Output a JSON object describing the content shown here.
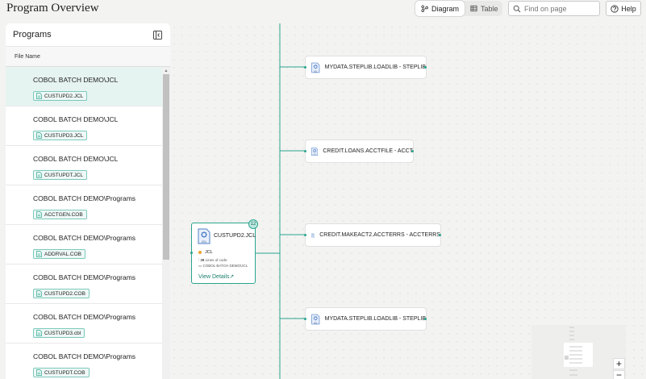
{
  "header": {
    "title": "Program Overview",
    "view_diagram": "Diagram",
    "view_table": "Table",
    "search_placeholder": "Find on page",
    "help": "Help"
  },
  "panel": {
    "title": "Programs",
    "column_header": "File Name",
    "items": [
      {
        "folder": "COBOL BATCH DEMO\\JCL",
        "file": "CUSTUPD2.JCL"
      },
      {
        "folder": "COBOL BATCH DEMO\\JCL",
        "file": "CUSTUPD3.JCL"
      },
      {
        "folder": "COBOL BATCH DEMO\\JCL",
        "file": "CUSTUPDT.JCL"
      },
      {
        "folder": "COBOL BATCH DEMO\\Programs",
        "file": "ACCTGEN.COB"
      },
      {
        "folder": "COBOL BATCH DEMO\\Programs",
        "file": "ADDRVAL.COB"
      },
      {
        "folder": "COBOL BATCH DEMO\\Programs",
        "file": "CUSTUPD2.COB"
      },
      {
        "folder": "COBOL BATCH DEMO\\Programs",
        "file": "CUSTUPD3.cbl"
      },
      {
        "folder": "COBOL BATCH DEMO\\Programs",
        "file": "CUSTUPDT.COB"
      }
    ]
  },
  "diagram": {
    "main_node": {
      "name": "CUSTUPD2.JCL",
      "badge": "12",
      "type": "JCL",
      "loc_value": "38",
      "loc_label": "Lines of code",
      "folder": "COBOL BATCH DEMO\\JCL",
      "link": "View Details"
    },
    "nodes": [
      {
        "label": "MYDATA.STEPLIB.LOADLIB - STEPLIB"
      },
      {
        "label": "CREDIT.LOANS.ACCTFILE - ACCT"
      },
      {
        "label": "CREDIT.MAKEACT2.ACCTERRS - ACCTERRS"
      },
      {
        "label": "MYDATA.STEPLIB.LOADLIB - STEPLIB"
      }
    ],
    "icon_text": "JCL"
  },
  "zoom": {
    "in": "+",
    "out": "−"
  },
  "colors": {
    "accent": "#2aa58f",
    "selected_row": "#e6f4f1",
    "jcl_icon": "#4f7fc6"
  }
}
